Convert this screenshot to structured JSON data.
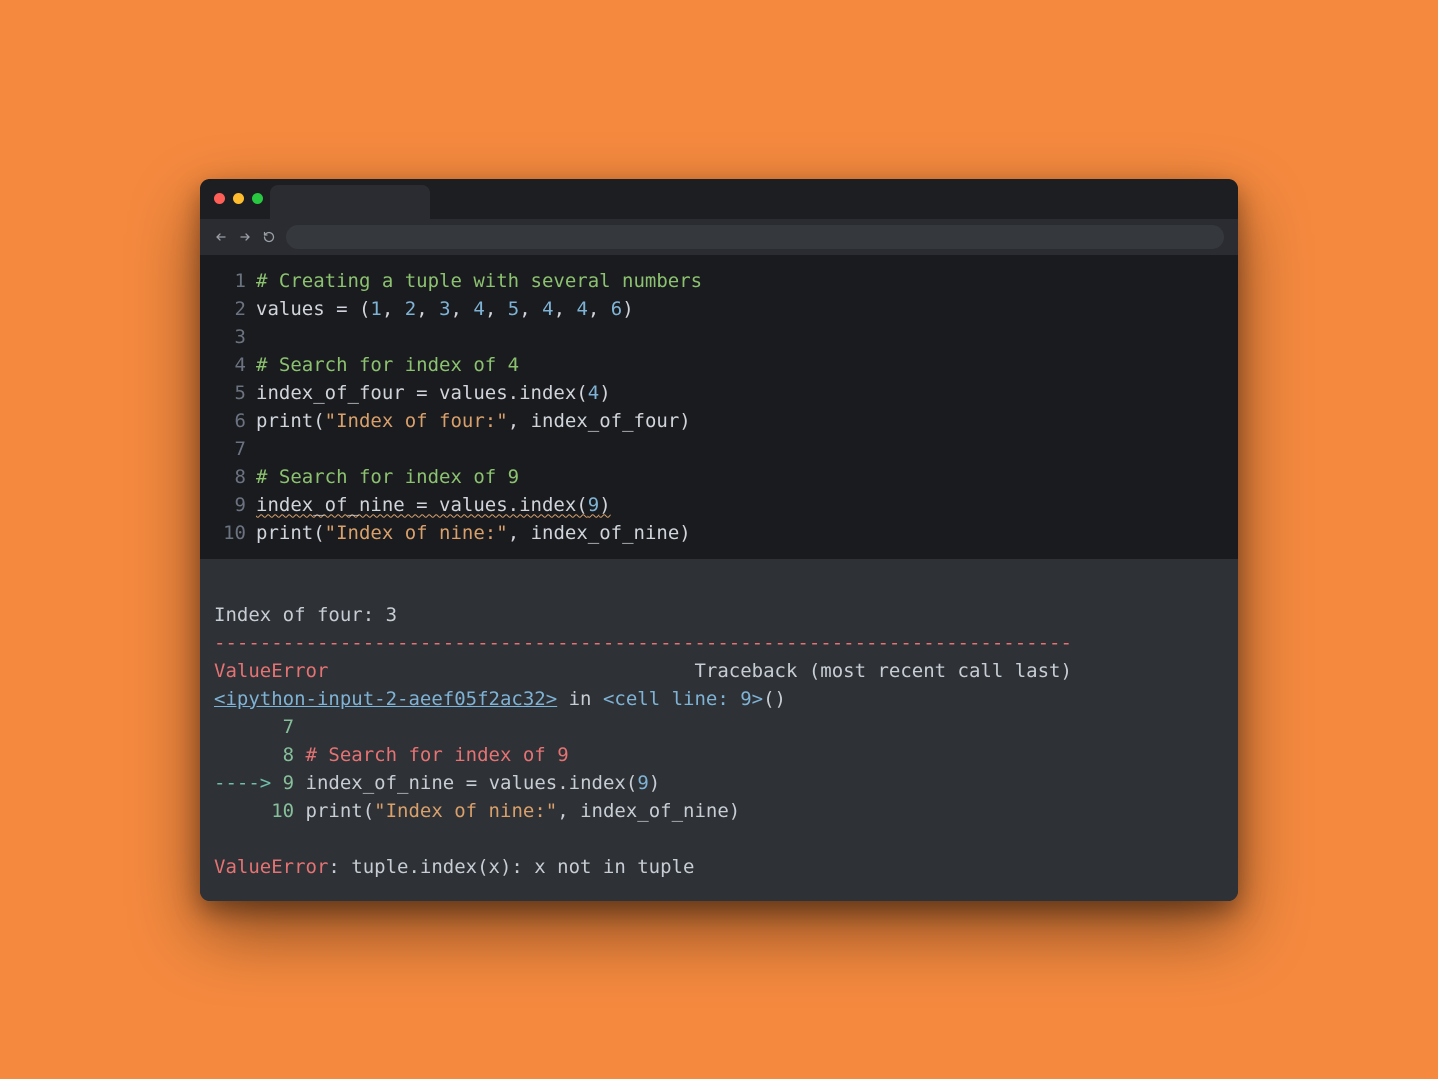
{
  "window": {
    "traffic": [
      "red",
      "yellow",
      "green"
    ]
  },
  "code": {
    "lines": [
      {
        "n": "1",
        "html": "<span class=\"c-comment\"># Creating a tuple with several numbers</span>"
      },
      {
        "n": "2",
        "html": "<span class=\"c-plain\">values = (</span><span class=\"c-num\">1</span><span class=\"c-plain\">, </span><span class=\"c-num\">2</span><span class=\"c-plain\">, </span><span class=\"c-num\">3</span><span class=\"c-plain\">, </span><span class=\"c-num\">4</span><span class=\"c-plain\">, </span><span class=\"c-num\">5</span><span class=\"c-plain\">, </span><span class=\"c-num\">4</span><span class=\"c-plain\">, </span><span class=\"c-num\">4</span><span class=\"c-plain\">, </span><span class=\"c-num\">6</span><span class=\"c-plain\">)</span>"
      },
      {
        "n": "3",
        "html": "<span class=\"c-plain\"></span>"
      },
      {
        "n": "4",
        "html": "<span class=\"c-comment\"># Search for index of 4</span>"
      },
      {
        "n": "5",
        "html": "<span class=\"c-plain\">index_of_four = values.index(</span><span class=\"c-num\">4</span><span class=\"c-plain\">)</span>"
      },
      {
        "n": "6",
        "html": "<span class=\"c-func\">print</span><span class=\"c-plain\">(</span><span class=\"c-str\">\"Index of four:\"</span><span class=\"c-plain\">, index_of_four)</span>"
      },
      {
        "n": "7",
        "html": "<span class=\"c-plain\"></span>"
      },
      {
        "n": "8",
        "html": "<span class=\"c-comment\"># Search for index of 9</span>"
      },
      {
        "n": "9",
        "html": "<span class=\"c-plain squiggle\">index_of_nine = values.index(</span><span class=\"c-num squiggle\">9</span><span class=\"c-plain squiggle\">)</span>"
      },
      {
        "n": "10",
        "html": "<span class=\"c-func\">print</span><span class=\"c-plain\">(</span><span class=\"c-str\">\"Index of nine:\"</span><span class=\"c-plain\">, index_of_nine)</span>"
      }
    ]
  },
  "output": {
    "print_line": "Index of four: 3",
    "sep": "---------------------------------------------------------------------------",
    "err_name": "ValueError",
    "tb_label_gap": "                                ",
    "tb_label": "Traceback (most recent call last)",
    "link": "<ipython-input-2-aeef05f2ac32>",
    "in_text": " in ",
    "cell_line": "<cell line: 9>",
    "paren": "()",
    "ln7_prefix": "      ",
    "ln7": "7",
    "ln8_prefix": "      ",
    "ln8": "8",
    "ln8_body": " # Search for index of 9",
    "arrow": "----> ",
    "ln9": "9",
    "ln9_body_a": " index_of_nine ",
    "ln9_eq": "=",
    "ln9_body_b": " values",
    "ln9_dot": ".",
    "ln9_idx": "index(",
    "ln9_num": "9",
    "ln9_close": ")",
    "ln10_prefix": "     ",
    "ln10": "10",
    "ln10_body_a": " print(",
    "ln10_str": "\"Index of nine:\"",
    "ln10_body_b": ", index_of_nine)",
    "final_err": "ValueError",
    "final_msg": ": tuple.index(x): x not in tuple"
  }
}
